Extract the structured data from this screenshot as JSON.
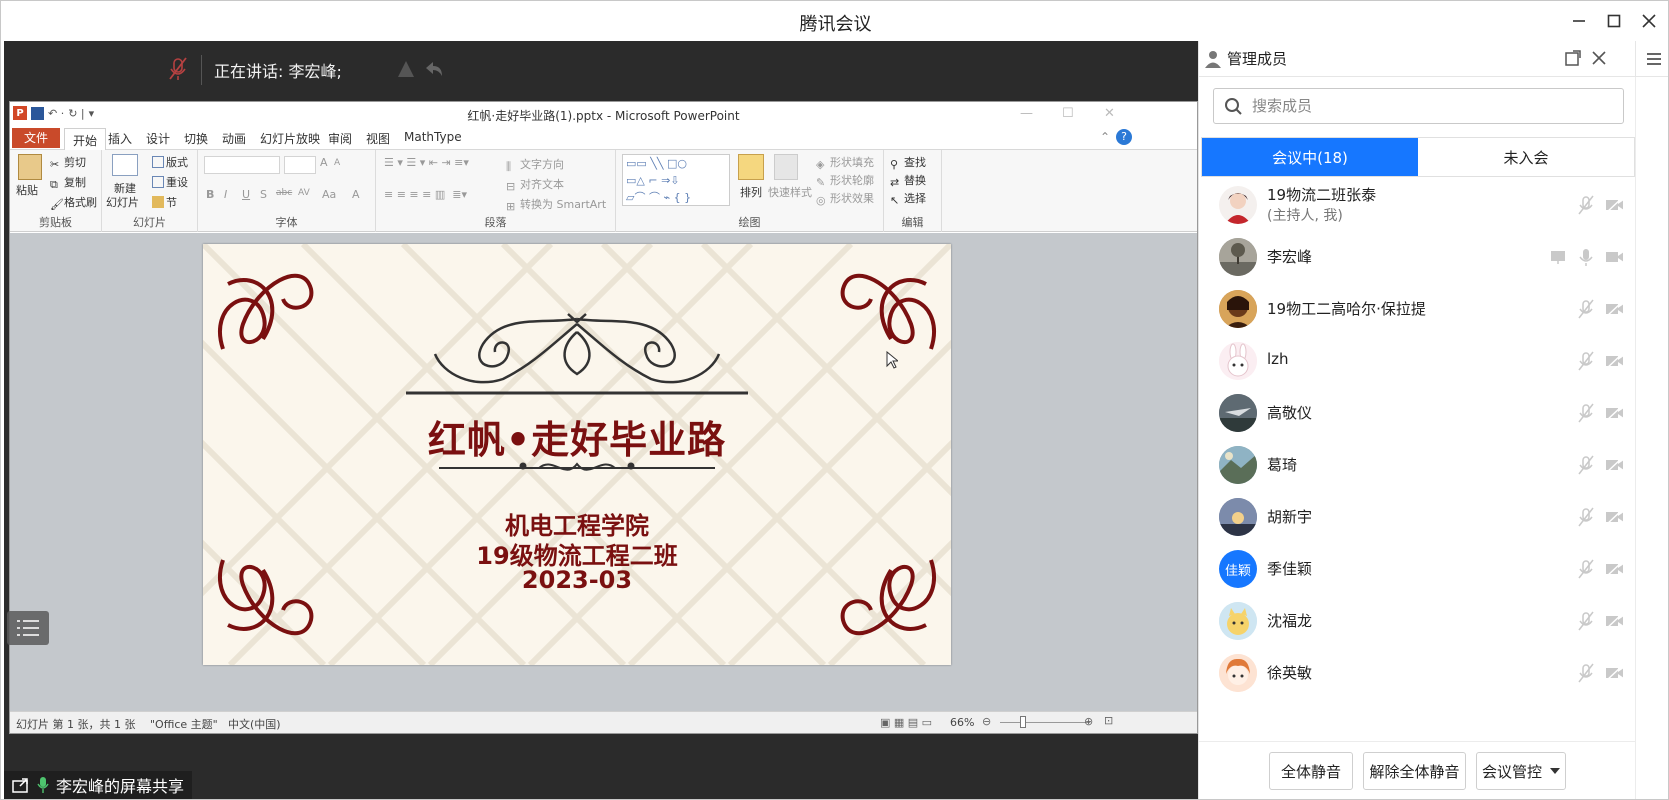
{
  "app": {
    "title": "腾讯会议"
  },
  "share": {
    "speaking_text": "正在讲话: 李宏峰;",
    "share_label": "李宏峰的屏幕共享"
  },
  "ppt": {
    "window_title": "红帆·走好毕业路(1).pptx - Microsoft PowerPoint",
    "logo_letter": "P",
    "tabs": [
      "文件",
      "开始",
      "插入",
      "设计",
      "切换",
      "动画",
      "幻灯片放映",
      "审阅",
      "视图",
      "MathType"
    ],
    "ribbon": {
      "clipboard": {
        "paste": "粘贴",
        "cut": "剪切",
        "copy": "复制",
        "format_painter": "格式刷",
        "label": "剪贴板"
      },
      "slides": {
        "new_slide_1": "新建",
        "new_slide_2": "幻灯片",
        "layout": "版式",
        "reset": "重设",
        "section": "节",
        "label": "幻灯片"
      },
      "font": {
        "label": "字体",
        "bold": "B",
        "italic": "I",
        "underline": "U",
        "shadow": "S",
        "strike": "abc",
        "spacing": "AV",
        "case": "Aa",
        "color": "A",
        "grow": "A",
        "shrink": "A"
      },
      "paragraph": {
        "text_direction": "文字方向",
        "align_text": "对齐文本",
        "smartart": "转换为 SmartArt",
        "label": "段落"
      },
      "drawing": {
        "arrange": "排列",
        "quick_styles": "快速样式",
        "shape_fill": "形状填充",
        "shape_outline": "形状轮廓",
        "shape_effects": "形状效果",
        "label": "绘图"
      },
      "editing": {
        "find": "查找",
        "replace": "替换",
        "select": "选择",
        "label": "编辑"
      }
    },
    "slide": {
      "title": "红帆•走好毕业路",
      "line1": "机电工程学院",
      "line2": "19级物流工程二班",
      "line3": "2023-03"
    },
    "status": {
      "slide_info": "幻灯片 第 1 张，共 1 张",
      "theme": "\"Office 主题\"",
      "language": "中文(中国)",
      "zoom": "66%"
    }
  },
  "panel": {
    "title": "管理成员",
    "search_placeholder": "搜索成员",
    "tab_in_meeting": "会议中(18)",
    "tab_not_joined": "未入会",
    "members": [
      {
        "name": "19物流二班张泰",
        "sub": "(主持人, 我)",
        "avatar": "anime-red"
      },
      {
        "name": "李宏峰",
        "sub": "",
        "avatar": "landscape-tree"
      },
      {
        "name": "19物工二高哈尔·保拉提",
        "sub": "",
        "avatar": "portrait"
      },
      {
        "name": "lzh",
        "sub": "",
        "avatar": "bunny"
      },
      {
        "name": "高敬仪",
        "sub": "",
        "avatar": "plane"
      },
      {
        "name": "葛琦",
        "sub": "",
        "avatar": "landscape-sky"
      },
      {
        "name": "胡新宇",
        "sub": "",
        "avatar": "sunset"
      },
      {
        "name": "季佳颖",
        "sub": "",
        "avatar": "text",
        "avatar_text": "佳颖"
      },
      {
        "name": "沈福龙",
        "sub": "",
        "avatar": "cartoon-cat"
      },
      {
        "name": "徐英敏",
        "sub": "",
        "avatar": "anime-girl"
      }
    ],
    "buttons": {
      "mute_all": "全体静音",
      "unmute_all": "解除全体静音",
      "meeting_control": "会议管控"
    }
  },
  "colors": {
    "accent": "#1677ff",
    "slide_text": "#7a1010",
    "muted_icon": "#c9c9c9"
  }
}
